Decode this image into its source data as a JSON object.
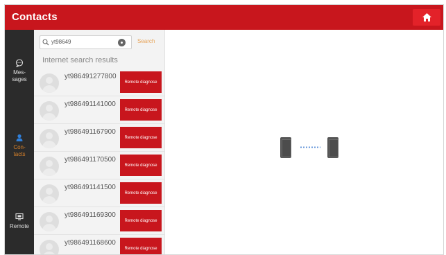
{
  "header": {
    "title": "Contacts"
  },
  "nav": {
    "items": [
      {
        "label_line1": "Mes-",
        "label_line2": "sages",
        "icon": "chat-icon",
        "active": false
      },
      {
        "label_line1": "Con-",
        "label_line2": "tacts",
        "icon": "contacts-icon",
        "active": true
      },
      {
        "label_line1": "Remote",
        "label_line2": "",
        "icon": "monitor-icon",
        "active": false
      }
    ]
  },
  "search": {
    "value": "yt98649",
    "button_label": "Search"
  },
  "results": {
    "heading": "Internet search results",
    "items": [
      {
        "name": "yt986491277800",
        "button": "Remote diagnose"
      },
      {
        "name": "yt986491141000",
        "button": "Remote diagnose"
      },
      {
        "name": "yt986491167900",
        "button": "Remote diagnose"
      },
      {
        "name": "yt986491170500",
        "button": "Remote diagnose"
      },
      {
        "name": "yt986491141500",
        "button": "Remote diagnose"
      },
      {
        "name": "yt986491169300",
        "button": "Remote diagnose"
      },
      {
        "name": "yt986491168600",
        "button": "Remote diagnose"
      }
    ]
  },
  "colors": {
    "brand_red": "#c8161d",
    "nav_bg": "#2b2b2b",
    "accent_orange": "#d9822b",
    "dots_blue": "#5b8fd8"
  }
}
